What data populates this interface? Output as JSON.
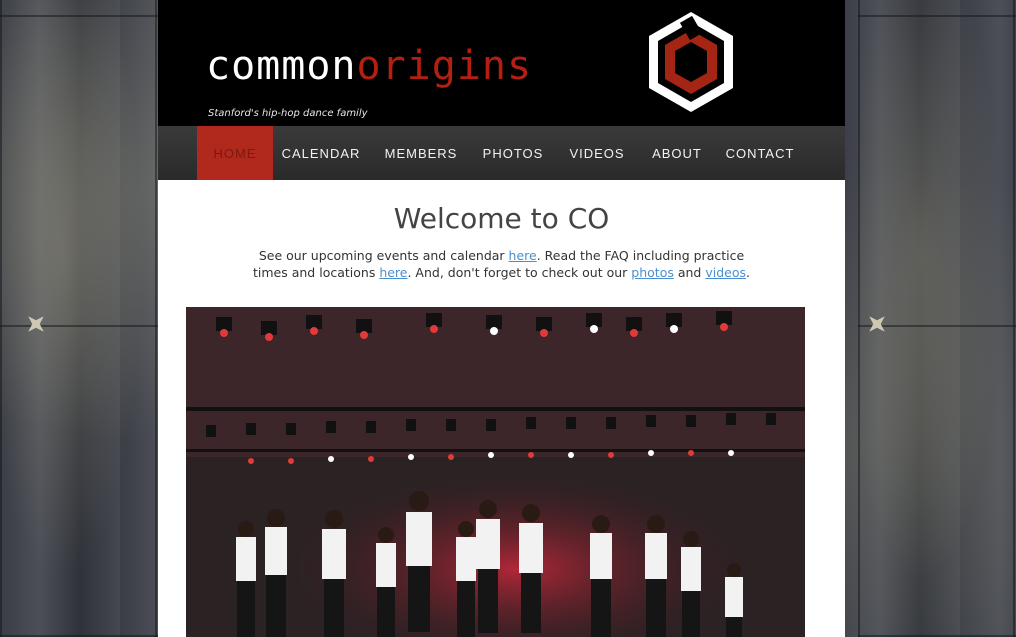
{
  "site": {
    "logo_common": "common",
    "logo_origins": "origins",
    "tagline": "Stanford's hip-hop dance family",
    "accent_color": "#b0291c",
    "logo_icon": "hexagon-logo-icon"
  },
  "nav": {
    "items": [
      {
        "label": "HOME",
        "active": true
      },
      {
        "label": "CALENDAR",
        "active": false
      },
      {
        "label": "MEMBERS",
        "active": false
      },
      {
        "label": "PHOTOS",
        "active": false
      },
      {
        "label": "VIDEOS",
        "active": false
      },
      {
        "label": "ABOUT",
        "active": false
      },
      {
        "label": "CONTACT",
        "active": false
      }
    ]
  },
  "main": {
    "title": "Welcome to CO",
    "intro": {
      "t1": "See our upcoming events and calendar ",
      "link_events": "here",
      "t2": ". Read the FAQ including practice times and locations ",
      "link_faq": "here",
      "t3": ". And, don't forget to check out our ",
      "link_photos": "photos",
      "t4": " and ",
      "link_videos": "videos",
      "t5": "."
    }
  }
}
